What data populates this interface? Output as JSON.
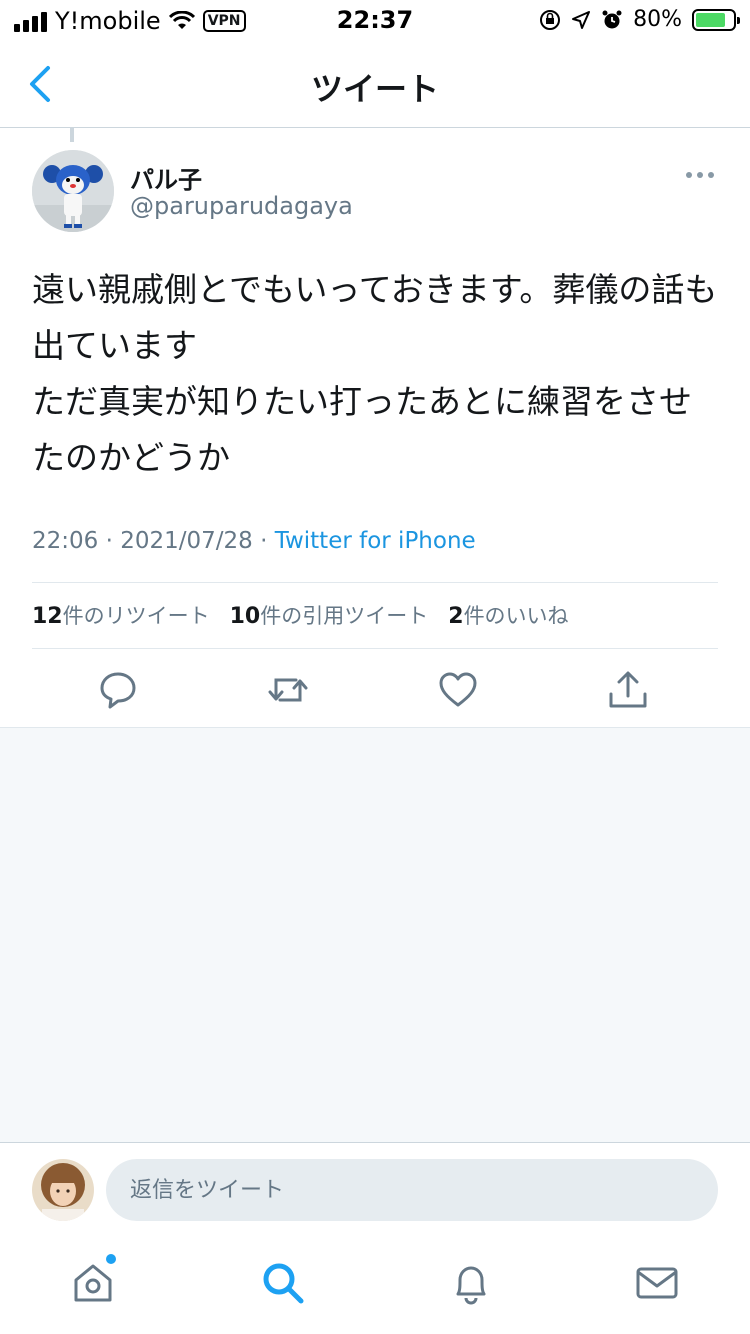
{
  "status_bar": {
    "carrier": "Y!mobile",
    "vpn": "VPN",
    "time": "22:37",
    "battery_percent": "80%",
    "battery_level": 0.8
  },
  "nav": {
    "title": "ツイート"
  },
  "tweet": {
    "user_name": "パル子",
    "user_handle": "@paruparudagaya",
    "text": "遠い親戚側とでもいっておきます。葬儀の話も出ています\nただ真実が知りたい打ったあとに練習をさせたのかどうか",
    "time": "22:06 · 2021/07/28 · ",
    "source": "Twitter for iPhone",
    "stats": {
      "retweets_count": "12",
      "retweets_label": "件のリツイート",
      "quotes_count": "10",
      "quotes_label": "件の引用ツイート",
      "likes_count": "2",
      "likes_label": "件のいいね"
    }
  },
  "reply": {
    "placeholder": "返信をツイート"
  },
  "colors": {
    "accent": "#1da1f2",
    "link": "#1b95e0",
    "secondary_text": "#657786",
    "icon_gray": "#657786"
  },
  "icons": {
    "reply": "reply-icon",
    "retweet": "retweet-icon",
    "like": "heart-icon",
    "share": "share-icon",
    "home": "home-icon",
    "search": "search-icon",
    "notifications": "bell-icon",
    "messages": "mail-icon"
  }
}
